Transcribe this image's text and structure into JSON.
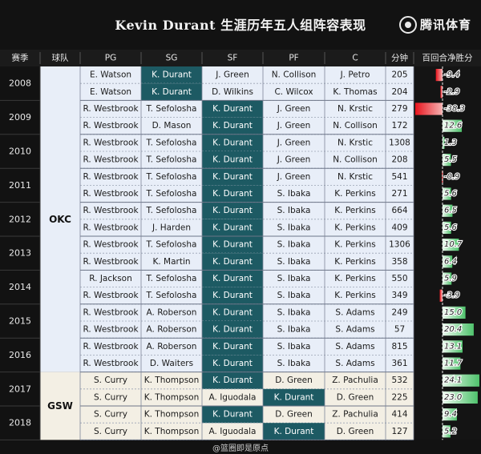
{
  "title": "Kevin Durant 生涯历年五人组阵容表现",
  "brand": {
    "name": "腾讯体育",
    "icon": "tencent-sports-logo-icon"
  },
  "watermark": "@篮圈即是原点",
  "colors": {
    "durant_cell": "#1d5a63",
    "okc_bg": "#e8eef8",
    "gsw_bg": "#f3efe4",
    "header_bg": "#1b1b1b",
    "positive": "#4fc26c",
    "negative": "#e8141d"
  },
  "chart_data": {
    "type": "table",
    "columns": [
      "赛季",
      "球队",
      "PG",
      "SG",
      "SF",
      "PF",
      "C",
      "分钟",
      "百回合净胜分"
    ],
    "groups": [
      {
        "team": "OKC",
        "seasons": [
          "2008",
          "2009",
          "2010",
          "2011",
          "2012",
          "2013",
          "2014",
          "2015",
          "2016"
        ]
      },
      {
        "team": "GSW",
        "seasons": [
          "2017",
          "2018"
        ]
      }
    ],
    "rows": [
      {
        "season": "2008",
        "team": "OKC",
        "PG": "E. Watson",
        "SG": "K. Durant",
        "SF": "J. Green",
        "PF": "N. Collison",
        "C": "J. Petro",
        "minutes": 205,
        "net": -9.4,
        "net_label": "-9.4",
        "durant_pos": "SG"
      },
      {
        "season": "2008",
        "team": "OKC",
        "PG": "E. Watson",
        "SG": "K. Durant",
        "SF": "D. Wilkins",
        "PF": "C. Wilcox",
        "C": "K. Thomas",
        "minutes": 204,
        "net": -2.9,
        "net_label": "-2.9",
        "durant_pos": "SG"
      },
      {
        "season": "2009",
        "team": "OKC",
        "PG": "R. Westbrook",
        "SG": "T. Sefolosha",
        "SF": "K. Durant",
        "PF": "J. Green",
        "C": "N. Krstic",
        "minutes": 279,
        "net": -38.3,
        "net_label": "-38.3",
        "durant_pos": "SF"
      },
      {
        "season": "2009",
        "team": "OKC",
        "PG": "R. Westbrook",
        "SG": "D. Mason",
        "SF": "K. Durant",
        "PF": "J. Green",
        "C": "N. Collison",
        "minutes": 172,
        "net": 12.6,
        "net_label": "12.6",
        "durant_pos": "SF"
      },
      {
        "season": "2010",
        "team": "OKC",
        "PG": "R. Westbrook",
        "SG": "T. Sefolosha",
        "SF": "K. Durant",
        "PF": "J. Green",
        "C": "N. Krstic",
        "minutes": 1308,
        "net": 1.3,
        "net_label": "1.3",
        "durant_pos": "SF"
      },
      {
        "season": "2010",
        "team": "OKC",
        "PG": "R. Westbrook",
        "SG": "T. Sefolosha",
        "SF": "K. Durant",
        "PF": "J. Green",
        "C": "N. Collison",
        "minutes": 208,
        "net": 5.5,
        "net_label": "5.5",
        "durant_pos": "SF"
      },
      {
        "season": "2011",
        "team": "OKC",
        "PG": "R. Westbrook",
        "SG": "T. Sefolosha",
        "SF": "K. Durant",
        "PF": "J. Green",
        "C": "N. Krstic",
        "minutes": 541,
        "net": -0.9,
        "net_label": "-0.9",
        "durant_pos": "SF"
      },
      {
        "season": "2011",
        "team": "OKC",
        "PG": "R. Westbrook",
        "SG": "T. Sefolosha",
        "SF": "K. Durant",
        "PF": "S. Ibaka",
        "C": "K. Perkins",
        "minutes": 271,
        "net": 5.6,
        "net_label": "5.6",
        "durant_pos": "SF"
      },
      {
        "season": "2012",
        "team": "OKC",
        "PG": "R. Westbrook",
        "SG": "T. Sefolosha",
        "SF": "K. Durant",
        "PF": "S. Ibaka",
        "C": "K. Perkins",
        "minutes": 664,
        "net": 6.5,
        "net_label": "6.5",
        "durant_pos": "SF"
      },
      {
        "season": "2012",
        "team": "OKC",
        "PG": "R. Westbrook",
        "SG": "J. Harden",
        "SF": "K. Durant",
        "PF": "S. Ibaka",
        "C": "K. Perkins",
        "minutes": 409,
        "net": 5.6,
        "net_label": "5.6",
        "durant_pos": "SF"
      },
      {
        "season": "2013",
        "team": "OKC",
        "PG": "R. Westbrook",
        "SG": "T. Sefolosha",
        "SF": "K. Durant",
        "PF": "S. Ibaka",
        "C": "K. Perkins",
        "minutes": 1306,
        "net": 10.7,
        "net_label": "10.7",
        "durant_pos": "SF"
      },
      {
        "season": "2013",
        "team": "OKC",
        "PG": "R. Westbrook",
        "SG": "K. Martin",
        "SF": "K. Durant",
        "PF": "S. Ibaka",
        "C": "K. Perkins",
        "minutes": 358,
        "net": 6.4,
        "net_label": "6.4",
        "durant_pos": "SF"
      },
      {
        "season": "2014",
        "team": "OKC",
        "PG": "R. Jackson",
        "SG": "T. Sefolosha",
        "SF": "K. Durant",
        "PF": "S. Ibaka",
        "C": "K. Perkins",
        "minutes": 550,
        "net": 5.9,
        "net_label": "5.9",
        "durant_pos": "SF"
      },
      {
        "season": "2014",
        "team": "OKC",
        "PG": "R. Westbrook",
        "SG": "T. Sefolosha",
        "SF": "K. Durant",
        "PF": "S. Ibaka",
        "C": "K. Perkins",
        "minutes": 349,
        "net": -3.9,
        "net_label": "-3.9",
        "durant_pos": "SF"
      },
      {
        "season": "2015",
        "team": "OKC",
        "PG": "R. Westbrook",
        "SG": "A. Roberson",
        "SF": "K. Durant",
        "PF": "S. Ibaka",
        "C": "S. Adams",
        "minutes": 249,
        "net": 15.0,
        "net_label": "15.0",
        "durant_pos": "SF"
      },
      {
        "season": "2015",
        "team": "OKC",
        "PG": "R. Westbrook",
        "SG": "A. Roberson",
        "SF": "K. Durant",
        "PF": "S. Ibaka",
        "C": "S. Adams",
        "minutes": 57,
        "net": 20.4,
        "net_label": "20.4",
        "durant_pos": "SF"
      },
      {
        "season": "2016",
        "team": "OKC",
        "PG": "R. Westbrook",
        "SG": "A. Roberson",
        "SF": "K. Durant",
        "PF": "S. Ibaka",
        "C": "S. Adams",
        "minutes": 815,
        "net": 13.1,
        "net_label": "13.1",
        "durant_pos": "SF"
      },
      {
        "season": "2016",
        "team": "OKC",
        "PG": "R. Westbrook",
        "SG": "D. Waiters",
        "SF": "K. Durant",
        "PF": "S. Ibaka",
        "C": "S. Adams",
        "minutes": 361,
        "net": 11.7,
        "net_label": "11.7",
        "durant_pos": "SF"
      },
      {
        "season": "2017",
        "team": "GSW",
        "PG": "S. Curry",
        "SG": "K. Thompson",
        "SF": "K. Durant",
        "PF": "D. Green",
        "C": "Z. Pachulia",
        "minutes": 532,
        "net": 24.1,
        "net_label": "24.1",
        "durant_pos": "SF"
      },
      {
        "season": "2017",
        "team": "GSW",
        "PG": "S. Curry",
        "SG": "K. Thompson",
        "SF": "A. Iguodala",
        "PF": "K. Durant",
        "C": "D. Green",
        "minutes": 225,
        "net": 23.0,
        "net_label": "23.0",
        "durant_pos": "PF"
      },
      {
        "season": "2018",
        "team": "GSW",
        "PG": "S. Curry",
        "SG": "K. Thompson",
        "SF": "K. Durant",
        "PF": "D. Green",
        "C": "Z. Pachulia",
        "minutes": 414,
        "net": 9.4,
        "net_label": "9.4",
        "durant_pos": "SF"
      },
      {
        "season": "2018",
        "team": "GSW",
        "PG": "S. Curry",
        "SG": "K. Thompson",
        "SF": "A. Iguodala",
        "PF": "K. Durant",
        "C": "D. Green",
        "minutes": 127,
        "net": 5.2,
        "net_label": "5.2",
        "durant_pos": "PF"
      }
    ],
    "net_axis": {
      "zero_line": "dashed",
      "range": [
        -38.3,
        24.1
      ]
    }
  }
}
